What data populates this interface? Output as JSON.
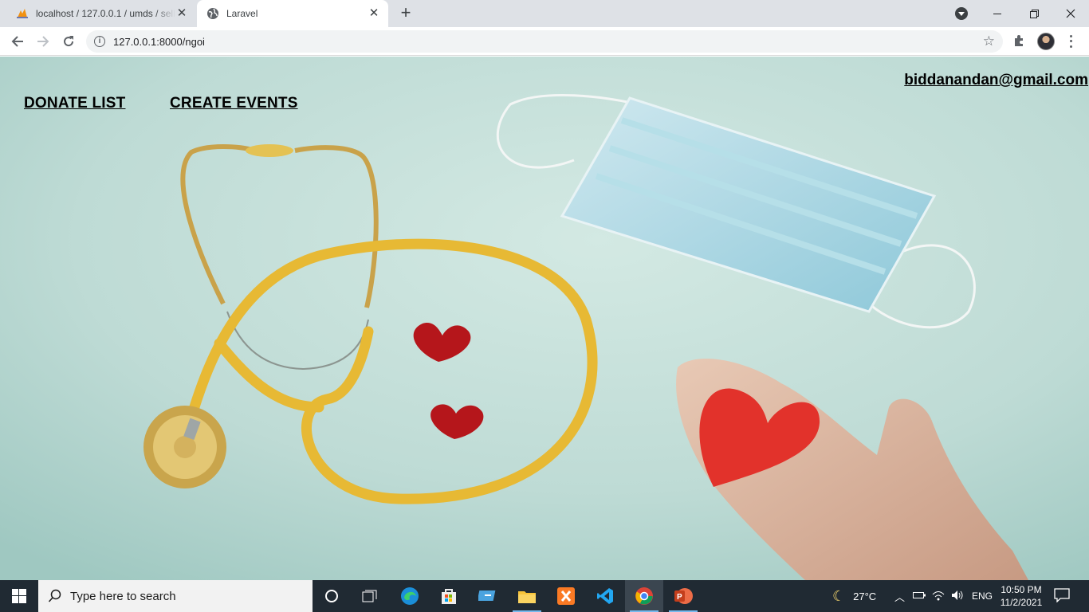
{
  "browser": {
    "tabs": [
      {
        "title": "localhost / 127.0.0.1 / umds / sell",
        "favicon": "phpmyadmin-icon"
      },
      {
        "title": "Laravel",
        "favicon": "globe-icon"
      }
    ],
    "url": "127.0.0.1:8000/ngoi"
  },
  "page": {
    "nav": {
      "donate_list": "DONATE LIST",
      "create_events": "CREATE EVENTS"
    },
    "user_email": "biddanandan@gmail.com"
  },
  "taskbar": {
    "search_placeholder": "Type here to search",
    "weather": "27°C",
    "language": "ENG",
    "time": "10:50 PM",
    "date": "11/2/2021",
    "apps": [
      "cortana-icon",
      "task-view-icon",
      "edge-icon",
      "store-icon",
      "remote-desktop-icon",
      "file-explorer-icon",
      "xampp-icon",
      "vscode-icon",
      "chrome-icon",
      "powerpoint-icon"
    ]
  },
  "colors": {
    "page_background": "#bfdcd6",
    "taskbar": "#202a33",
    "tab_strip": "#dee1e6"
  }
}
